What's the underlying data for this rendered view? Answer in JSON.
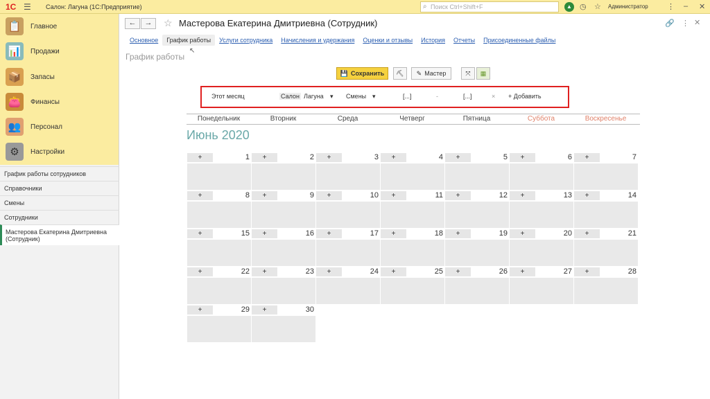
{
  "topbar": {
    "logo": "1С",
    "title": "Салон: Лагуна  (1С:Предприятие)",
    "search_placeholder": "Поиск Ctrl+Shift+F",
    "user": "Администратор"
  },
  "sidebar": {
    "sections": [
      {
        "label": "Главное",
        "icon": "clipboard-icon"
      },
      {
        "label": "Продажи",
        "icon": "chart-icon"
      },
      {
        "label": "Запасы",
        "icon": "box-icon"
      },
      {
        "label": "Финансы",
        "icon": "wallet-icon"
      },
      {
        "label": "Персонал",
        "icon": "people-icon"
      },
      {
        "label": "Настройки",
        "icon": "gear-icon"
      }
    ],
    "links": [
      "График работы сотрудников",
      "Справочники",
      "Смены",
      "Сотрудники",
      "Мастерова Екатерина Дмитриевна (Сотрудник)"
    ]
  },
  "document": {
    "title": "Мастерова Екатерина Дмитриевна (Сотрудник)",
    "tabs": [
      "Основное",
      "График работы",
      "Услуги сотрудника",
      "Начисления и удержания",
      "Оценки и отзывы",
      "История",
      "Отчеты",
      "Присоединенные файлы"
    ],
    "active_tab": "График работы",
    "section_title": "График работы"
  },
  "toolbar": {
    "save_label": "Сохранить",
    "master_label": "Мастер"
  },
  "filters": {
    "period": "Этот месяц",
    "salon_label": "Салон",
    "salon_value": "Лагуна",
    "shifts": "Смены",
    "from": "[...]",
    "dash": "-",
    "to": "[...]",
    "clear": "×",
    "add_label": "+ Добавить"
  },
  "calendar": {
    "month": "Июнь 2020",
    "weekdays": [
      "Понедельник",
      "Вторник",
      "Среда",
      "Четверг",
      "Пятница",
      "Суббота",
      "Воскресенье"
    ],
    "weekend_color": "#e0826a",
    "plus_label": "+",
    "days": [
      1,
      2,
      3,
      4,
      5,
      6,
      7,
      8,
      9,
      10,
      11,
      12,
      13,
      14,
      15,
      16,
      17,
      18,
      19,
      20,
      21,
      22,
      23,
      24,
      25,
      26,
      27,
      28,
      29,
      30
    ]
  }
}
